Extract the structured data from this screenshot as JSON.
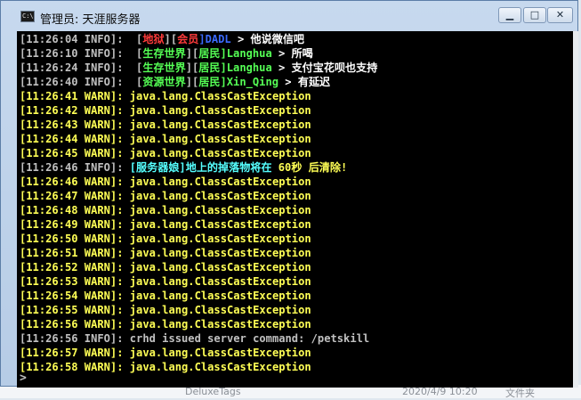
{
  "window": {
    "title": "管理员: 天涯服务器",
    "icon_label": "C:\\",
    "controls": {
      "minimize": "▁",
      "maximize": "□",
      "close": "✕"
    }
  },
  "console": {
    "lines": [
      [
        {
          "t": "[11:26:04 INFO]:  [",
          "c": "white"
        },
        {
          "t": "地狱",
          "c": "red"
        },
        {
          "t": "][",
          "c": "white"
        },
        {
          "t": "会员",
          "c": "red"
        },
        {
          "t": "]DADL",
          "c": "blue"
        },
        {
          "t": " > 他说微信吧",
          "c": "bright"
        }
      ],
      [
        {
          "t": "[11:26:10 INFO]:  [",
          "c": "white"
        },
        {
          "t": "生存世界",
          "c": "green"
        },
        {
          "t": "][",
          "c": "white"
        },
        {
          "t": "居民",
          "c": "green"
        },
        {
          "t": "]Langhua",
          "c": "green"
        },
        {
          "t": " > 所喝",
          "c": "bright"
        }
      ],
      [
        {
          "t": "[11:26:24 INFO]:  [",
          "c": "white"
        },
        {
          "t": "生存世界",
          "c": "green"
        },
        {
          "t": "][",
          "c": "white"
        },
        {
          "t": "居民",
          "c": "green"
        },
        {
          "t": "]Langhua",
          "c": "green"
        },
        {
          "t": " > 支付宝花呗也支持",
          "c": "bright"
        }
      ],
      [
        {
          "t": "[11:26:40 INFO]:  [",
          "c": "white"
        },
        {
          "t": "资源世界",
          "c": "green"
        },
        {
          "t": "][",
          "c": "white"
        },
        {
          "t": "居民",
          "c": "green"
        },
        {
          "t": "]Xin_Qing",
          "c": "green"
        },
        {
          "t": " > 有延迟",
          "c": "bright"
        }
      ],
      [
        {
          "t": "[11:26:41 WARN]: java.lang.ClassCastException",
          "c": "yellow"
        }
      ],
      [
        {
          "t": "[11:26:42 WARN]: java.lang.ClassCastException",
          "c": "yellow"
        }
      ],
      [
        {
          "t": "[11:26:43 WARN]: java.lang.ClassCastException",
          "c": "yellow"
        }
      ],
      [
        {
          "t": "[11:26:44 WARN]: java.lang.ClassCastException",
          "c": "yellow"
        }
      ],
      [
        {
          "t": "[11:26:45 WARN]: java.lang.ClassCastException",
          "c": "yellow"
        }
      ],
      [
        {
          "t": "[11:26:46 INFO]: ",
          "c": "white"
        },
        {
          "t": "[服务器娘]",
          "c": "aqua"
        },
        {
          "t": "地上的掉落物将在 ",
          "c": "aqua"
        },
        {
          "t": "60",
          "c": "yellow"
        },
        {
          "t": "秒 后清除!",
          "c": "yellow"
        }
      ],
      [
        {
          "t": "[11:26:46 WARN]: java.lang.ClassCastException",
          "c": "yellow"
        }
      ],
      [
        {
          "t": "[11:26:47 WARN]: java.lang.ClassCastException",
          "c": "yellow"
        }
      ],
      [
        {
          "t": "[11:26:48 WARN]: java.lang.ClassCastException",
          "c": "yellow"
        }
      ],
      [
        {
          "t": "[11:26:49 WARN]: java.lang.ClassCastException",
          "c": "yellow"
        }
      ],
      [
        {
          "t": "[11:26:50 WARN]: java.lang.ClassCastException",
          "c": "yellow"
        }
      ],
      [
        {
          "t": "[11:26:51 WARN]: java.lang.ClassCastException",
          "c": "yellow"
        }
      ],
      [
        {
          "t": "[11:26:52 WARN]: java.lang.ClassCastException",
          "c": "yellow"
        }
      ],
      [
        {
          "t": "[11:26:53 WARN]: java.lang.ClassCastException",
          "c": "yellow"
        }
      ],
      [
        {
          "t": "[11:26:54 WARN]: java.lang.ClassCastException",
          "c": "yellow"
        }
      ],
      [
        {
          "t": "[11:26:55 WARN]: java.lang.ClassCastException",
          "c": "yellow"
        }
      ],
      [
        {
          "t": "[11:26:56 WARN]: java.lang.ClassCastException",
          "c": "yellow"
        }
      ],
      [
        {
          "t": "[11:26:56 INFO]: crhd issued server command: /petskill",
          "c": "gray"
        }
      ],
      [
        {
          "t": "[11:26:57 WARN]: java.lang.ClassCastException",
          "c": "yellow"
        }
      ],
      [
        {
          "t": "[11:26:58 WARN]: java.lang.ClassCastException",
          "c": "yellow"
        }
      ]
    ],
    "prompt": ">"
  },
  "desktop": {
    "file_name": "DeluxeTags",
    "file_date": "2020/4/9 10:20",
    "file_type": "文件夹"
  }
}
